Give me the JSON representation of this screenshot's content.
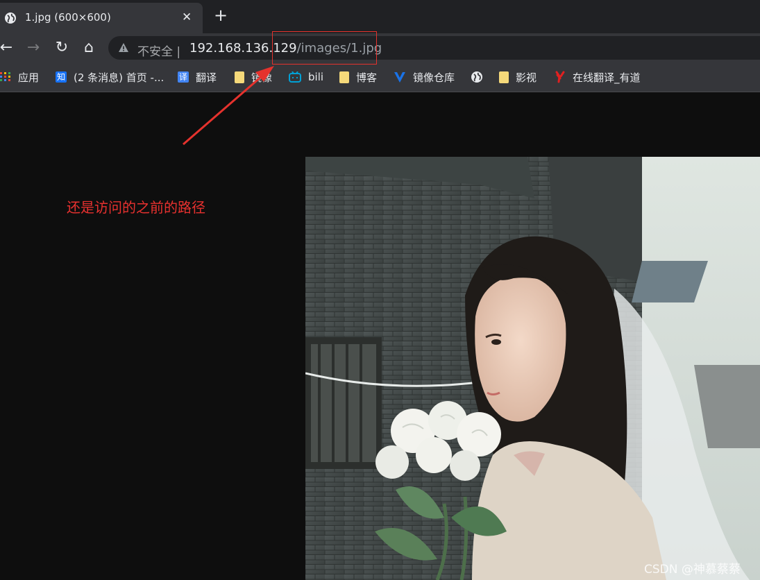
{
  "tab": {
    "title": "1.jpg (600×600)",
    "close": "✕",
    "new_tab": "+"
  },
  "toolbar": {
    "back": "←",
    "forward": "→",
    "reload": "↻",
    "home": "⌂",
    "insecure_label": "不安全 |",
    "url_host": "192.168.136.129",
    "url_path": "/images/1.jpg"
  },
  "bookmarks": [
    {
      "label": "应用",
      "icon": "apps-grid-icon"
    },
    {
      "label": "(2 条消息) 首页 -...",
      "icon": "zhihu-icon",
      "glyph": "知"
    },
    {
      "label": "翻译",
      "icon": "translate-icon",
      "glyph": "译"
    },
    {
      "label": "镜像",
      "icon": "folder-icon"
    },
    {
      "label": "bili",
      "icon": "bilibili-tv-icon"
    },
    {
      "label": "博客",
      "icon": "folder-icon"
    },
    {
      "label": "镜像仓库",
      "icon": "v-logo-icon"
    },
    {
      "label": "",
      "icon": "globe-icon"
    },
    {
      "label": "影视",
      "icon": "folder-icon"
    },
    {
      "label": "在线翻译_有道",
      "icon": "youdao-icon"
    }
  ],
  "annotation": {
    "text": "还是访问的之前的路径",
    "color": "#e8312f"
  },
  "watermark": "CSDN @神慕蔡蔡",
  "colors": {
    "tabstrip": "#202124",
    "toolbar": "#35363a",
    "page_bg": "#0e0e0e",
    "annotation": "#e5322d"
  }
}
